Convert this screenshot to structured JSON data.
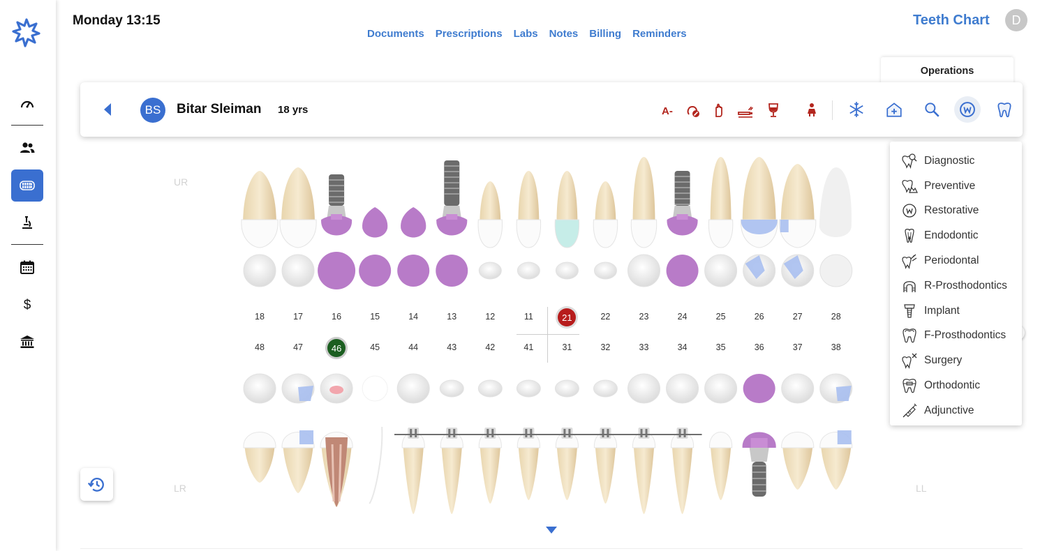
{
  "header": {
    "datetime": "Monday 13:15",
    "tabs": [
      {
        "label": "Documents"
      },
      {
        "label": "Prescriptions"
      },
      {
        "label": "Labs"
      },
      {
        "label": "Notes"
      },
      {
        "label": "Billing"
      },
      {
        "label": "Reminders"
      }
    ],
    "page_title": "Teeth Chart",
    "user_initial": "D"
  },
  "sidebar": {
    "items": [
      {
        "icon": "dashboard-icon",
        "active": false
      },
      {
        "icon": "patients-icon",
        "active": false
      },
      {
        "icon": "teeth-icon",
        "active": true
      },
      {
        "icon": "microscope-icon",
        "active": false
      },
      {
        "icon": "calendar-icon",
        "active": false
      },
      {
        "icon": "dollar-icon",
        "active": false
      },
      {
        "icon": "bank-icon",
        "active": false
      }
    ]
  },
  "patient": {
    "initials": "BS",
    "name": "Bitar Sleiman",
    "age": "18 yrs",
    "alert_label": "A-"
  },
  "operations": {
    "tab_label": "Operations",
    "items": [
      {
        "label": "Diagnostic"
      },
      {
        "label": "Preventive"
      },
      {
        "label": "Restorative"
      },
      {
        "label": "Endodontic"
      },
      {
        "label": "Periodontal"
      },
      {
        "label": "R-Prosthodontics"
      },
      {
        "label": "Implant"
      },
      {
        "label": "F-Prosthodontics"
      },
      {
        "label": "Surgery"
      },
      {
        "label": "Orthodontic"
      },
      {
        "label": "Adjunctive"
      }
    ]
  },
  "chart": {
    "quadrants": {
      "upper_right": "UR",
      "lower_right": "LR",
      "lower_left": "LL"
    },
    "upper_numbers": [
      "18",
      "17",
      "16",
      "15",
      "14",
      "13",
      "12",
      "11",
      "21",
      "22",
      "23",
      "24",
      "25",
      "26",
      "27",
      "28"
    ],
    "lower_numbers": [
      "48",
      "47",
      "46",
      "45",
      "44",
      "43",
      "42",
      "41",
      "31",
      "32",
      "33",
      "34",
      "35",
      "36",
      "37",
      "38"
    ],
    "selected_upper": "21",
    "selected_lower": "46",
    "colors": {
      "accent": "#3f7ccf",
      "active_nav": "#3a6fd0",
      "alert_red": "#b3261e",
      "filling_purple": "#b87bc8",
      "composite_blue": "#a8bff0",
      "selected_red": "#b71c1c",
      "selected_green": "#1b5e20"
    }
  }
}
